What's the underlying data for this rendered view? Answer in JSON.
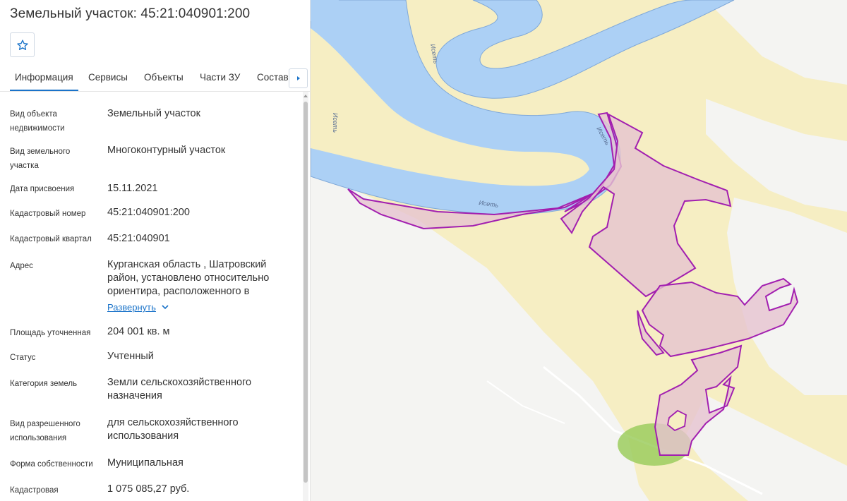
{
  "header": {
    "title": "Земельный участок: 45:21:040901:200"
  },
  "tabs": [
    {
      "label": "Информация",
      "active": true
    },
    {
      "label": "Сервисы",
      "active": false
    },
    {
      "label": "Объекты",
      "active": false
    },
    {
      "label": "Части ЗУ",
      "active": false
    },
    {
      "label": "Состав",
      "active": false
    }
  ],
  "info": {
    "object_type": {
      "label": "Вид объекта недвижимости",
      "value": "Земельный участок"
    },
    "land_type": {
      "label": "Вид земельного участка",
      "value": "Многоконтурный участок"
    },
    "assigned_date": {
      "label": "Дата присвоения",
      "value": "15.11.2021"
    },
    "cadastral_number": {
      "label": "Кадастровый номер",
      "value": "45:21:040901:200"
    },
    "cadastral_quarter": {
      "label": "Кадастровый квартал",
      "value": "45:21:040901"
    },
    "address": {
      "label": "Адрес",
      "value": "Курганская область , Шатровский район, установлено относительно ориентира, расположенного в",
      "expand_label": "Развернуть"
    },
    "area": {
      "label": "Площадь уточненная",
      "value": "204 001 кв. м"
    },
    "status": {
      "label": "Статус",
      "value": "Учтенный"
    },
    "land_category": {
      "label": "Категория земель",
      "value": "Земли сельскохозяйственного назначения"
    },
    "permitted_use": {
      "label": "Вид разрешенного использования",
      "value": "для сельскохозяйственного использования"
    },
    "ownership": {
      "label": "Форма собственности",
      "value": "Муниципальная"
    },
    "cadastral_value": {
      "label": "Кадастровая",
      "value": "1 075 085,27 руб."
    }
  },
  "map": {
    "river_labels": [
      "Исеть",
      "Исеть",
      "Исеть",
      "Исеть"
    ],
    "colors": {
      "land": "#f6eec3",
      "land_white": "#f4f4f2",
      "river": "#acd0f5",
      "river_edge": "#7fa8d8",
      "parcel_fill": "#e6c3cf",
      "parcel_stroke": "#a21fb0",
      "forest": "#9ccd5f"
    }
  },
  "icons": {
    "favorite": "star-outline-icon",
    "tabs_next": "triangle-right-icon",
    "expand": "chevron-down-icon"
  }
}
